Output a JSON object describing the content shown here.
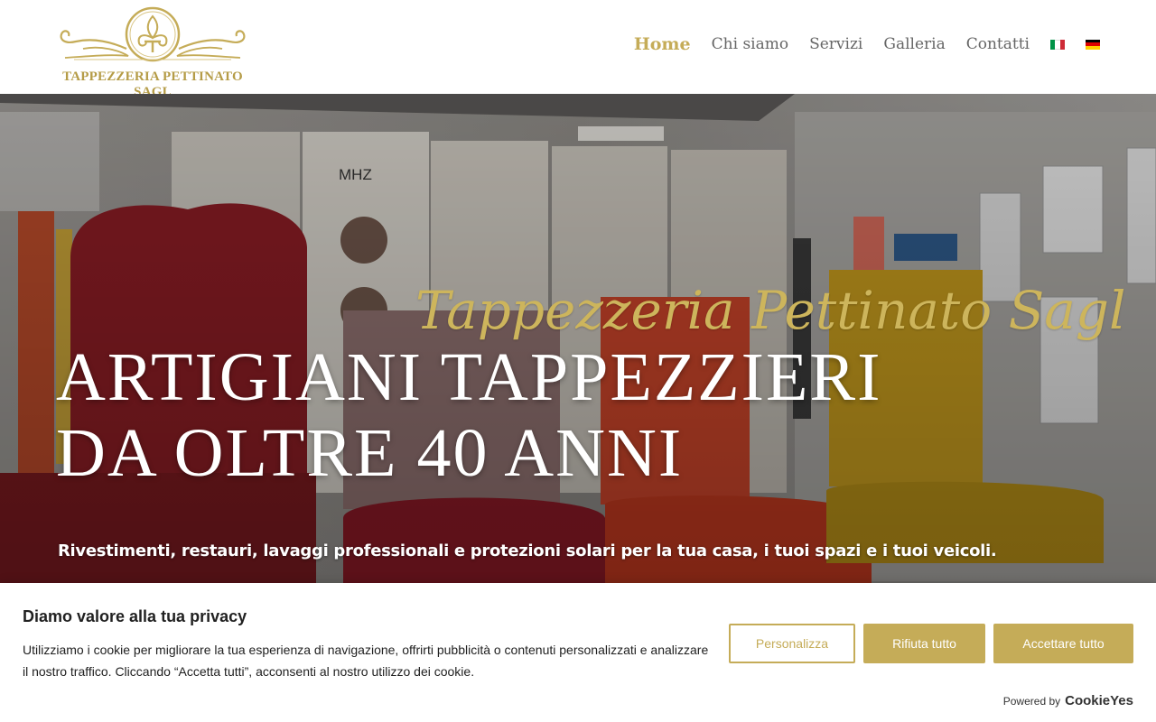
{
  "header": {
    "logo_text": "TAPPEZZERIA PETTINATO SAGL",
    "nav": [
      {
        "label": "Home",
        "active": true
      },
      {
        "label": "Chi siamo",
        "active": false
      },
      {
        "label": "Servizi",
        "active": false
      },
      {
        "label": "Galleria",
        "active": false
      },
      {
        "label": "Contatti",
        "active": false
      }
    ],
    "languages": [
      "it-flag-icon",
      "de-flag-icon"
    ]
  },
  "hero": {
    "script_title": "Tappezzeria Pettinato Sagl",
    "title_line1": "ARTIGIANI TAPPEZZIERI",
    "title_line2": "DA OLTRE 40 ANNI",
    "subtitle": "Rivestimenti, restauri, lavaggi professionali e protezioni solari per la tua casa, i tuoi spazi e i tuoi veicoli.",
    "sign_text": "MHZ"
  },
  "cookie_banner": {
    "title": "Diamo valore alla tua privacy",
    "text": "Utilizziamo i cookie per migliorare la tua esperienza di navigazione, offrirti pubblicità o contenuti personalizzati e analizzare il nostro traffico. Cliccando “Accetta tutti”, acconsenti al nostro utilizzo dei cookie.",
    "btn_customize": "Personalizza",
    "btn_reject": "Rifiuta tutto",
    "btn_accept": "Accettare tutto",
    "powered_by": "Powered by",
    "powered_brand": "CookieYes"
  },
  "colors": {
    "accent": "#c5ac58",
    "text_dark": "#212121",
    "nav_text": "#666666"
  }
}
